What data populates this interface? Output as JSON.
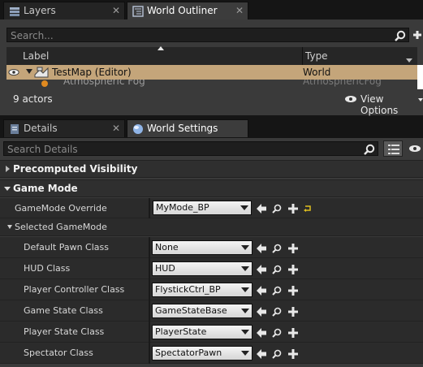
{
  "outliner": {
    "tabs": [
      {
        "label": "Layers",
        "close": "✕"
      },
      {
        "label": "World Outliner",
        "close": "✕"
      }
    ],
    "search_placeholder": "Search...",
    "columns": {
      "label": "Label",
      "type": "Type"
    },
    "rows": [
      {
        "label": "TestMap (Editor)",
        "type": "World"
      },
      {
        "label": "Atmospheric Fog",
        "type": "AtmosphericFog"
      }
    ],
    "footer": {
      "count": "9 actors",
      "view_options": "View Options"
    }
  },
  "details": {
    "tabs": [
      {
        "label": "Details",
        "close": "✕"
      },
      {
        "label": "World Settings"
      }
    ],
    "search_placeholder": "Search Details",
    "categories": {
      "precomputed": "Precomputed Visibility",
      "game_mode": "Game Mode",
      "selected_game_mode": "Selected GameMode"
    },
    "gamemode_override": {
      "label": "GameMode Override",
      "value": "MyMode_BP"
    },
    "properties": [
      {
        "label": "Default Pawn Class",
        "value": "None"
      },
      {
        "label": "HUD Class",
        "value": "HUD"
      },
      {
        "label": "Player Controller Class",
        "value": "FlystickCtrl_BP"
      },
      {
        "label": "Game State Class",
        "value": "GameStateBase"
      },
      {
        "label": "Player State Class",
        "value": "PlayerState"
      },
      {
        "label": "Spectator Class",
        "value": "SpectatorPawn"
      }
    ]
  },
  "colors": {
    "accent_selected_row": "#c4a57a",
    "panel": "#3a3a3a",
    "reset_arrow": "#e0c020"
  }
}
